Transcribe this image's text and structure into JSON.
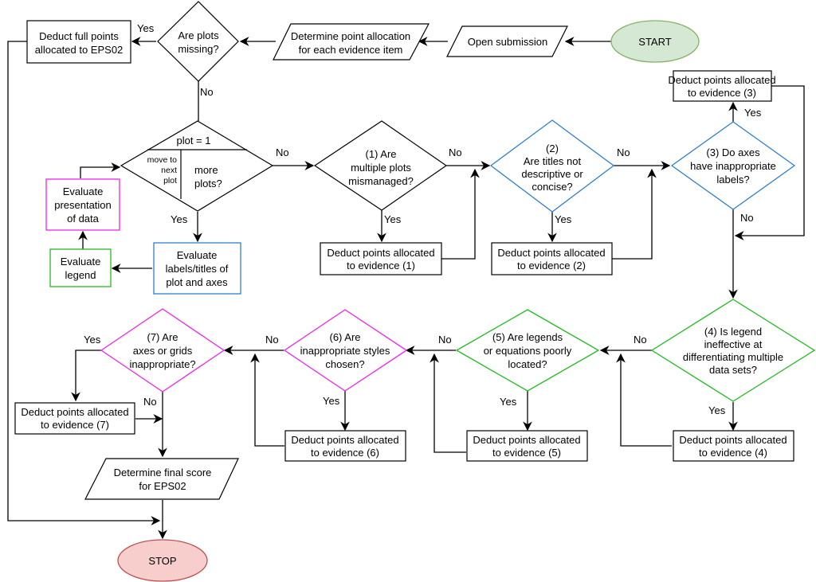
{
  "colors": {
    "black": "#000000",
    "blue": "#2f7fd0",
    "green": "#22bb22",
    "magenta": "#ee22ee",
    "start_fill": "#d5e8d4",
    "start_stroke": "#82b366",
    "stop_fill": "#f8cecc",
    "stop_stroke": "#b85450"
  },
  "nodes": {
    "start": {
      "lines": [
        "START"
      ]
    },
    "open_submission": {
      "lines": [
        "Open submission"
      ]
    },
    "determine_allocation": {
      "lines": [
        "Determine point allocation",
        "for each evidence item"
      ]
    },
    "plots_missing": {
      "lines": [
        "Are plots",
        "missing?"
      ]
    },
    "deduct_full": {
      "lines": [
        "Deduct full points",
        "allocated to EPS02"
      ]
    },
    "loop": {
      "top": "plot = 1",
      "left_lines": [
        "move to",
        "next",
        "plot"
      ],
      "right_lines": [
        "more",
        "plots?"
      ]
    },
    "eval_labels": {
      "lines": [
        "Evaluate",
        "labels/titles of",
        "plot and axes"
      ]
    },
    "eval_legend": {
      "lines": [
        "Evaluate",
        "legend"
      ]
    },
    "eval_presentation": {
      "lines": [
        "Evaluate",
        "presentation",
        "of data"
      ]
    },
    "q1": {
      "lines": [
        "(1) Are",
        "multiple plots",
        "mismanaged?"
      ]
    },
    "d1": {
      "lines": [
        "Deduct points allocated",
        "to evidence (1)"
      ]
    },
    "q2": {
      "lines": [
        "(2)",
        "Are titles not",
        "descriptive or",
        "concise?"
      ]
    },
    "d2": {
      "lines": [
        "Deduct points allocated",
        "to evidence (2)"
      ]
    },
    "q3": {
      "lines": [
        "(3) Do axes",
        "have inappropriate",
        "labels?"
      ]
    },
    "d3": {
      "lines": [
        "Deduct points allocated",
        "to evidence (3)"
      ]
    },
    "q4": {
      "lines": [
        "(4) Is legend",
        "ineffective at",
        "differentiating multiple",
        "data sets?"
      ]
    },
    "d4": {
      "lines": [
        "Deduct points allocated",
        "to evidence (4)"
      ]
    },
    "q5": {
      "lines": [
        "(5) Are legends",
        "or equations poorly",
        "located?"
      ]
    },
    "d5": {
      "lines": [
        "Deduct points allocated",
        "to evidence (5)"
      ]
    },
    "q6": {
      "lines": [
        "(6) Are",
        "inappropriate styles",
        "chosen?"
      ]
    },
    "d6": {
      "lines": [
        "Deduct points allocated",
        "to evidence (6)"
      ]
    },
    "q7": {
      "lines": [
        "(7) Are",
        "axes or grids",
        "inappropriate?"
      ]
    },
    "d7": {
      "lines": [
        "Deduct points allocated",
        "to evidence (7)"
      ]
    },
    "final_score": {
      "lines": [
        "Determine final score",
        "for EPS02"
      ]
    },
    "stop": {
      "lines": [
        "STOP"
      ]
    }
  },
  "edge_labels": {
    "yes": "Yes",
    "no": "No"
  }
}
